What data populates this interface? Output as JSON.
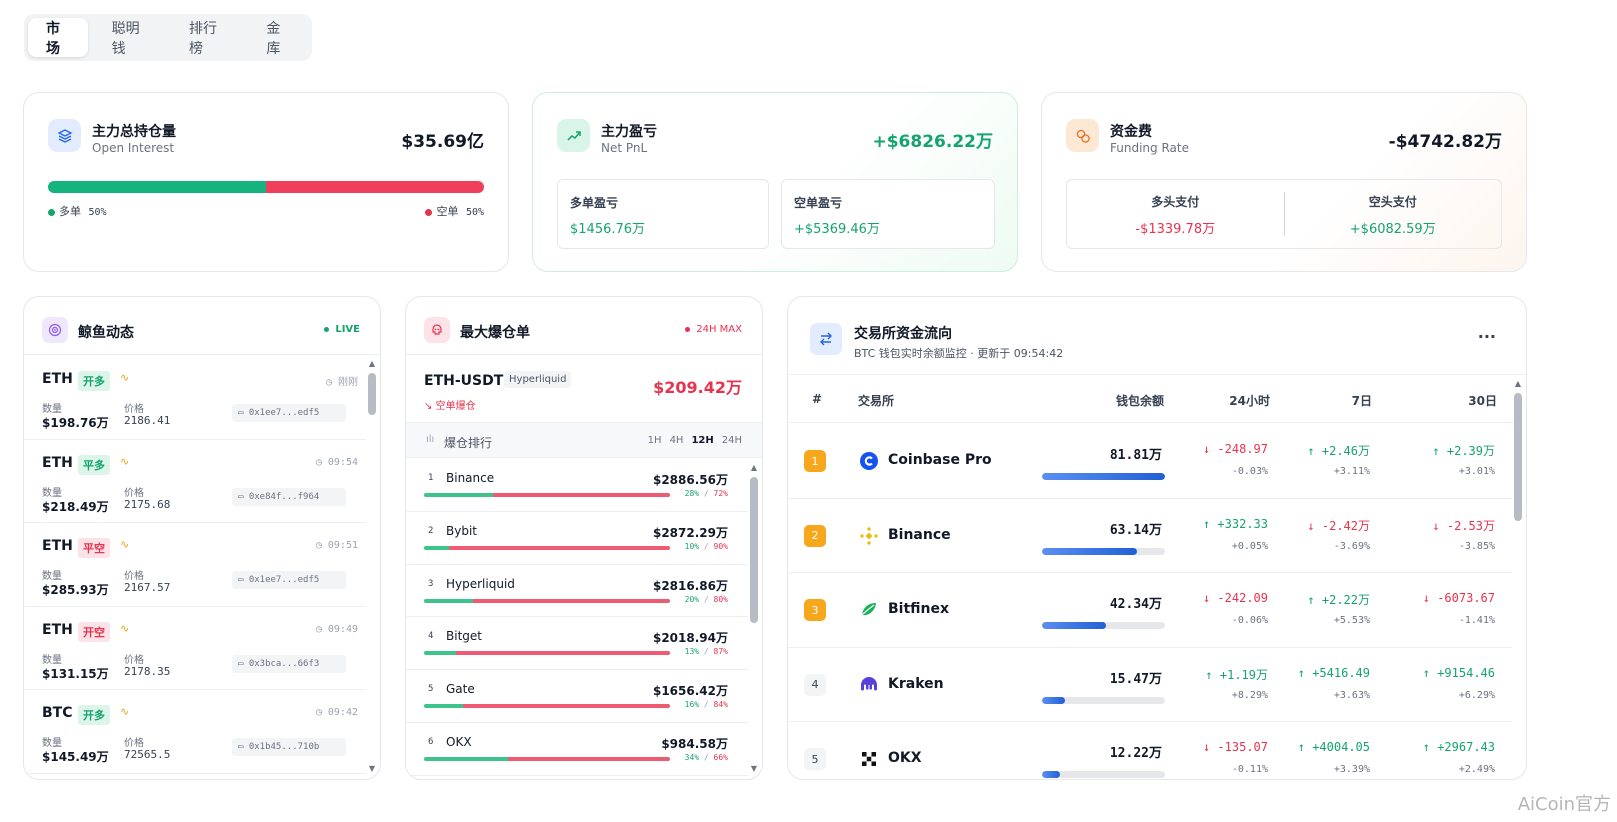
{
  "tabs": [
    "市场",
    "聪明钱",
    "排行榜",
    "金库"
  ],
  "open_interest": {
    "title": "主力总持仓量",
    "subtitle": "Open Interest",
    "value": "$35.69亿",
    "long_label": "多单",
    "long_pct": "50%",
    "short_label": "空单",
    "short_pct": "50%",
    "long_fraction": 0.5
  },
  "net_pnl": {
    "title": "主力盈亏",
    "subtitle": "Net PnL",
    "value": "+$6826.22万",
    "long_label": "多单盈亏",
    "long_value": "$1456.76万",
    "short_label": "空单盈亏",
    "short_value": "+$5369.46万"
  },
  "funding": {
    "title": "资金费",
    "subtitle": "Funding Rate",
    "value": "-$4742.82万",
    "long_label": "多头支付",
    "long_value": "-$1339.78万",
    "short_label": "空头支付",
    "short_value": "+$6082.59万"
  },
  "whale": {
    "title": "鲸鱼动态",
    "badge": "LIVE",
    "qty_label": "数量",
    "price_label": "价格",
    "rows": [
      {
        "symbol": "ETH",
        "tag": "开多",
        "side": "long",
        "time": "刚刚",
        "qty": "$198.76万",
        "price": "2186.41",
        "addr": "0x1ee7...edf5"
      },
      {
        "symbol": "ETH",
        "tag": "平多",
        "side": "long",
        "time": "09:54",
        "qty": "$218.49万",
        "price": "2175.68",
        "addr": "0xe84f...f964"
      },
      {
        "symbol": "ETH",
        "tag": "平空",
        "side": "short",
        "time": "09:51",
        "qty": "$285.93万",
        "price": "2167.57",
        "addr": "0x1ee7...edf5"
      },
      {
        "symbol": "ETH",
        "tag": "开空",
        "side": "short",
        "time": "09:49",
        "qty": "$131.15万",
        "price": "2178.35",
        "addr": "0x3bca...66f3"
      },
      {
        "symbol": "BTC",
        "tag": "开多",
        "side": "long",
        "time": "09:42",
        "qty": "$145.49万",
        "price": "72565.5",
        "addr": "0x1b45...710b"
      }
    ]
  },
  "liquidation": {
    "title": "最大爆仓单",
    "badge": "24H MAX",
    "symbol": "ETH-USDT",
    "exchange": "Hyperliquid",
    "amount": "$209.42万",
    "tag": "空单爆仓",
    "rank_title": "爆仓排行",
    "timeframes": [
      "1H",
      "4H",
      "12H",
      "24H"
    ],
    "active_tf": "12H",
    "rows": [
      {
        "idx": "1",
        "name": "Binance",
        "amount": "$2886.56万",
        "long_pct": 28,
        "long": "28%",
        "short": "72%"
      },
      {
        "idx": "2",
        "name": "Bybit",
        "amount": "$2872.29万",
        "long_pct": 10,
        "long": "10%",
        "short": "90%"
      },
      {
        "idx": "3",
        "name": "Hyperliquid",
        "amount": "$2816.86万",
        "long_pct": 20,
        "long": "20%",
        "short": "80%"
      },
      {
        "idx": "4",
        "name": "Bitget",
        "amount": "$2018.94万",
        "long_pct": 13,
        "long": "13%",
        "short": "87%"
      },
      {
        "idx": "5",
        "name": "Gate",
        "amount": "$1656.42万",
        "long_pct": 16,
        "long": "16%",
        "short": "84%"
      },
      {
        "idx": "6",
        "name": "OKX",
        "amount": "$984.58万",
        "long_pct": 34,
        "long": "34%",
        "short": "66%"
      }
    ]
  },
  "exchange_flow": {
    "title": "交易所资金流向",
    "subtitle": "BTC 钱包实时余额监控 · 更新于 09:54:42",
    "more": "···",
    "headers": {
      "rank": "#",
      "exchange": "交易所",
      "balance": "钱包余额",
      "h24": "24小时",
      "d7": "7日",
      "d30": "30日"
    },
    "rows": [
      {
        "rank": "1",
        "name": "Coinbase Pro",
        "logo": "coinbase-logo",
        "balance": "81.81万",
        "fill": 1.0,
        "h24": "↓ -248.97",
        "h24p": "-0.03%",
        "h24dir": "down",
        "d7": "↑ +2.46万",
        "d7p": "+3.11%",
        "d7dir": "up",
        "d30": "↑ +2.39万",
        "d30p": "+3.01%",
        "d30dir": "up"
      },
      {
        "rank": "2",
        "name": "Binance",
        "logo": "binance-logo",
        "balance": "63.14万",
        "fill": 0.77,
        "h24": "↑ +332.33",
        "h24p": "+0.05%",
        "h24dir": "up",
        "d7": "↓ -2.42万",
        "d7p": "-3.69%",
        "d7dir": "down",
        "d30": "↓ -2.53万",
        "d30p": "-3.85%",
        "d30dir": "down"
      },
      {
        "rank": "3",
        "name": "Bitfinex",
        "logo": "bitfinex-logo",
        "balance": "42.34万",
        "fill": 0.52,
        "h24": "↓ -242.09",
        "h24p": "-0.06%",
        "h24dir": "down",
        "d7": "↑ +2.22万",
        "d7p": "+5.53%",
        "d7dir": "up",
        "d30": "↓ -6073.67",
        "d30p": "-1.41%",
        "d30dir": "down"
      },
      {
        "rank": "4",
        "name": "Kraken",
        "logo": "kraken-logo",
        "balance": "15.47万",
        "fill": 0.19,
        "h24": "↑ +1.19万",
        "h24p": "+8.29%",
        "h24dir": "up",
        "d7": "↑ +5416.49",
        "d7p": "+3.63%",
        "d7dir": "up",
        "d30": "↑ +9154.46",
        "d30p": "+6.29%",
        "d30dir": "up"
      },
      {
        "rank": "5",
        "name": "OKX",
        "logo": "okx-logo",
        "balance": "12.22万",
        "fill": 0.15,
        "h24": "↓ -135.07",
        "h24p": "-0.11%",
        "h24dir": "down",
        "d7": "↑ +4004.05",
        "d7p": "+3.39%",
        "d7dir": "up",
        "d30": "↑ +2967.43",
        "d30p": "+2.49%",
        "d30dir": "up"
      }
    ]
  },
  "watermark": "AiCoin官方",
  "colors": {
    "long": "#15a36e",
    "short": "#e8334f",
    "accent": "#2563eb",
    "rank_gold": "#f7a71b"
  }
}
